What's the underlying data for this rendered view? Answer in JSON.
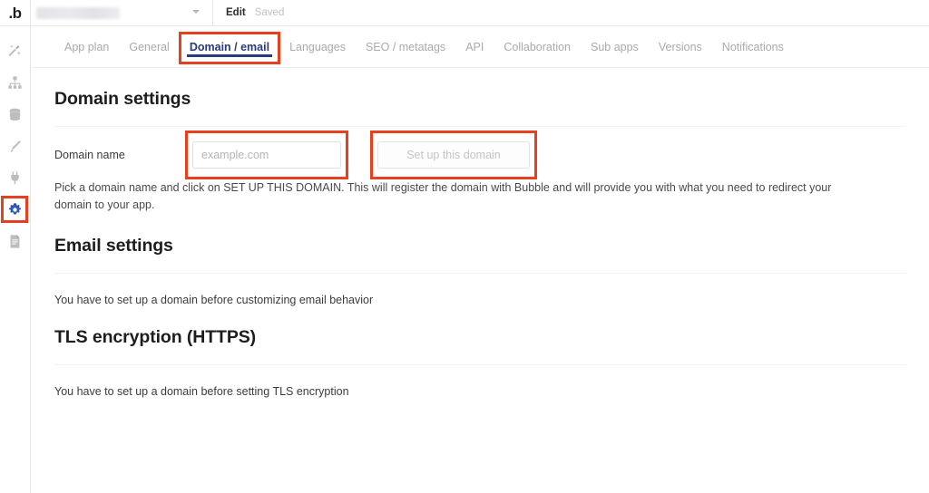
{
  "topbar": {
    "logo": "b-logo-icon",
    "logo_text": ".b",
    "app_name": "",
    "app_name_redacted": true,
    "dropdown_icon": "chevron-down-icon",
    "edit_label": "Edit",
    "save_status": "Saved"
  },
  "sidebar": {
    "items": [
      {
        "name": "design",
        "icon": "wand-icon",
        "active": false
      },
      {
        "name": "workflow",
        "icon": "hierarchy-icon",
        "active": false
      },
      {
        "name": "data",
        "icon": "database-icon",
        "active": false
      },
      {
        "name": "styles",
        "icon": "brush-icon",
        "active": false
      },
      {
        "name": "plugins",
        "icon": "plug-icon",
        "active": false
      },
      {
        "name": "settings",
        "icon": "gear-icon",
        "active": true
      },
      {
        "name": "logs",
        "icon": "document-icon",
        "active": false
      }
    ]
  },
  "tabs": [
    {
      "label": "App plan",
      "active": false
    },
    {
      "label": "General",
      "active": false
    },
    {
      "label": "Domain / email",
      "active": true
    },
    {
      "label": "Languages",
      "active": false
    },
    {
      "label": "SEO / metatags",
      "active": false
    },
    {
      "label": "API",
      "active": false
    },
    {
      "label": "Collaboration",
      "active": false
    },
    {
      "label": "Sub apps",
      "active": false
    },
    {
      "label": "Versions",
      "active": false
    },
    {
      "label": "Notifications",
      "active": false
    }
  ],
  "domain_section": {
    "heading": "Domain settings",
    "field_label": "Domain name",
    "input_placeholder": "example.com",
    "input_value": "",
    "button_label": "Set up this domain",
    "button_disabled": true,
    "helper_text": "Pick a domain name and click on SET UP THIS DOMAIN. This will register the domain with Bubble and will provide you with what you need to redirect your domain to your app."
  },
  "email_section": {
    "heading": "Email settings",
    "body": "You have to set up a domain before customizing email behavior"
  },
  "tls_section": {
    "heading": "TLS encryption (HTTPS)",
    "body": "You have to set up a domain before setting TLS encryption"
  },
  "colors": {
    "highlight": "#e8401f",
    "active_tab": "#2a3c7d",
    "active_icon": "#2e5bb8",
    "muted_text": "#a9aaaf",
    "border": "#e6e6e8"
  }
}
